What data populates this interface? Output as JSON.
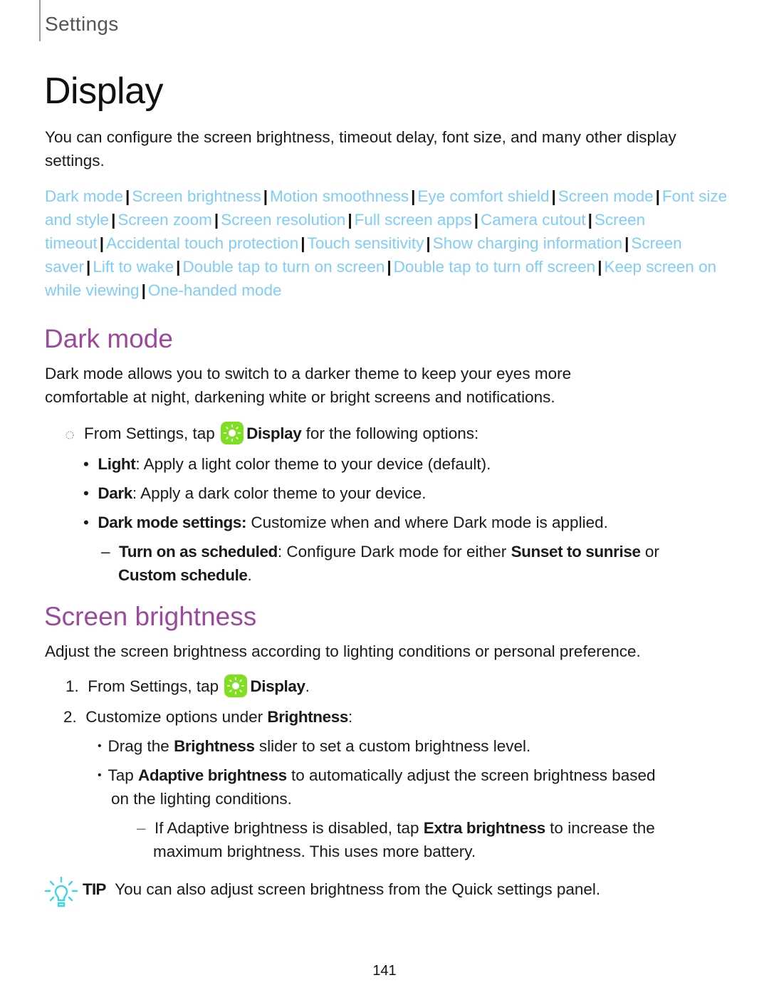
{
  "header": {
    "section_label": "Settings"
  },
  "page": {
    "title": "Display",
    "number": "141"
  },
  "intro": "You can configure the screen brightness, timeout delay, font size, and many other display settings.",
  "topic_links": [
    "Dark mode",
    "Screen brightness",
    "Motion smoothness",
    "Eye comfort shield",
    "Screen mode",
    "Font size and style",
    "Screen zoom",
    "Screen resolution",
    "Full screen apps",
    "Camera cutout",
    "Screen timeout",
    "Accidental touch protection",
    "Touch sensitivity",
    "Show charging information",
    "Screen saver",
    "Lift to wake",
    "Double tap to turn on screen",
    "Double tap to turn off screen",
    "Keep screen on while viewing",
    "One-handed mode"
  ],
  "colors": {
    "link": "#7fcdf8",
    "heading": "#9b4a9b",
    "app_icon": "#7fe022",
    "tip_icon": "#3ad6e6"
  },
  "dark_mode": {
    "heading": "Dark mode",
    "description": "Dark mode allows you to switch to a darker theme to keep your eyes more comfortable at night, darkening white or bright screens and notifications.",
    "step": {
      "prefix": "From Settings, tap",
      "app": "Display",
      "suffix": "for the following options:",
      "app_icon": "display-settings-icon"
    },
    "options": [
      {
        "label": "Light",
        "text": ": Apply a light color theme to your device (default)."
      },
      {
        "label": "Dark",
        "text": ": Apply a dark color theme to your device."
      },
      {
        "label": "Dark mode settings:",
        "text": " Customize when and where Dark mode is applied."
      }
    ],
    "sub_option": {
      "label": "Turn on as scheduled",
      "text1": ": Configure Dark mode for either ",
      "bold1": "Sunset to sunrise",
      "text2": " or",
      "bold2": "Custom schedule",
      "text3": "."
    }
  },
  "screen_brightness": {
    "heading": "Screen brightness",
    "description": "Adjust the screen brightness according to lighting conditions or personal preference.",
    "steps": [
      {
        "num": "1.",
        "prefix": "From Settings, tap",
        "app": "Display",
        "suffix": "."
      },
      {
        "num": "2.",
        "prefix": "Customize options under ",
        "bold": "Brightness",
        "suffix": ":"
      }
    ],
    "bullets": [
      {
        "pre": "Drag the ",
        "bold": "Brightness",
        "post": " slider to set a custom brightness level."
      },
      {
        "pre": "Tap ",
        "bold": "Adaptive brightness",
        "post": " to automatically adjust the screen brightness based",
        "cont": "on the lighting conditions."
      }
    ],
    "sub_bullet": {
      "pre": "If Adaptive brightness is disabled, tap ",
      "bold": "Extra brightness",
      "post": " to increase the",
      "cont": "maximum brightness. This uses more battery."
    }
  },
  "tip": {
    "label": "TIP",
    "text": "You can also adjust screen brightness from the Quick settings panel."
  }
}
